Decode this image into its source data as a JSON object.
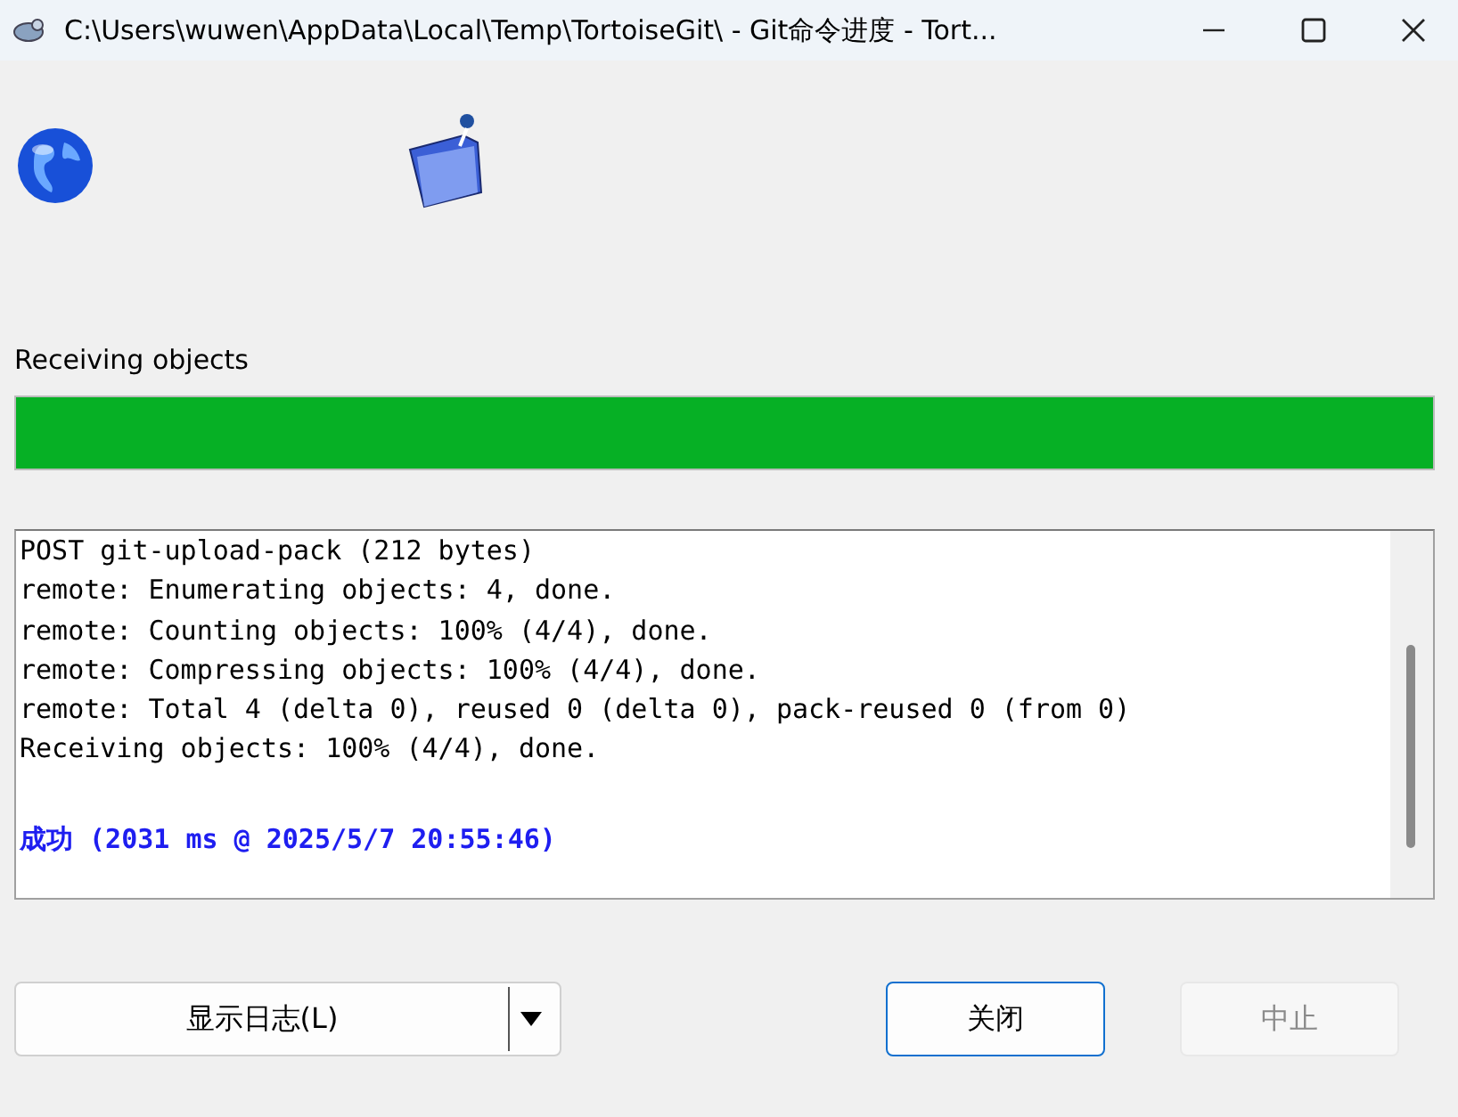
{
  "window": {
    "title": "C:\\Users\\wuwen\\AppData\\Local\\Temp\\TortoiseGit\\ - Git命令进度 - Tort..."
  },
  "status": {
    "label": "Receiving objects",
    "level": 1.0
  },
  "log": [
    {
      "kind": "normal",
      "text": "POST git-upload-pack (212 bytes)"
    },
    {
      "kind": "normal",
      "text": "remote: Enumerating objects: 4, done."
    },
    {
      "kind": "normal",
      "text": "remote: Counting objects: 100% (4/4), done."
    },
    {
      "kind": "normal",
      "text": "remote: Compressing objects: 100% (4/4), done."
    },
    {
      "kind": "normal",
      "text": "remote: Total 4 (delta 0), reused 0 (delta 0), pack-reused 0 (from 0)"
    },
    {
      "kind": "normal",
      "text": "Receiving objects: 100% (4/4), done."
    },
    {
      "kind": "success",
      "text": "成功 (2031 ms @ 2025/5/7 20:55:46)"
    }
  ],
  "buttons": [
    {
      "kind": "split",
      "label": "显示日志(L)",
      "focused": false,
      "disabled": false
    },
    {
      "kind": "plain",
      "label": "关闭",
      "focused": true,
      "disabled": false
    },
    {
      "kind": "plain",
      "label": "中止",
      "focused": false,
      "disabled": true
    }
  ]
}
